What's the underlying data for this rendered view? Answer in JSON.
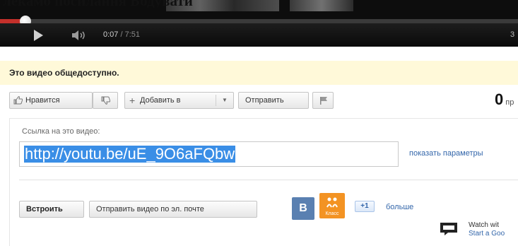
{
  "caption": {
    "text": "лекамо посилання Бодувати"
  },
  "player": {
    "current_time": "0:07",
    "duration": "/ 7:51",
    "progress_fraction": 0.015,
    "progress_color": "#c4302b",
    "quality_label": "3"
  },
  "notice": {
    "text": "Это видео общедоступно."
  },
  "actions": {
    "like_label": "Нравится",
    "add_label": "Добавить в",
    "share_label": "Отправить",
    "views_count": "0",
    "views_suffix": "пр"
  },
  "share": {
    "link_label": "Ссылка на это видео:",
    "link_value": "http://youtu.be/uE_9O6aFQbw",
    "params_link": "показать параметры",
    "embed_button": "Встроить",
    "email_button": "Отправить видео по эл. почте",
    "vk_letter": "B",
    "ok_label": "Класс",
    "gplus_label": "+1",
    "more_link": "больше"
  },
  "watch_promo": {
    "line1": "Watch wit",
    "line2": "Start a Goo"
  },
  "colors": {
    "notice_bg": "#fff9d9",
    "link_highlight": "#3a8ee6",
    "vk_blue": "#5a80b1",
    "ok_orange": "#f39323"
  }
}
